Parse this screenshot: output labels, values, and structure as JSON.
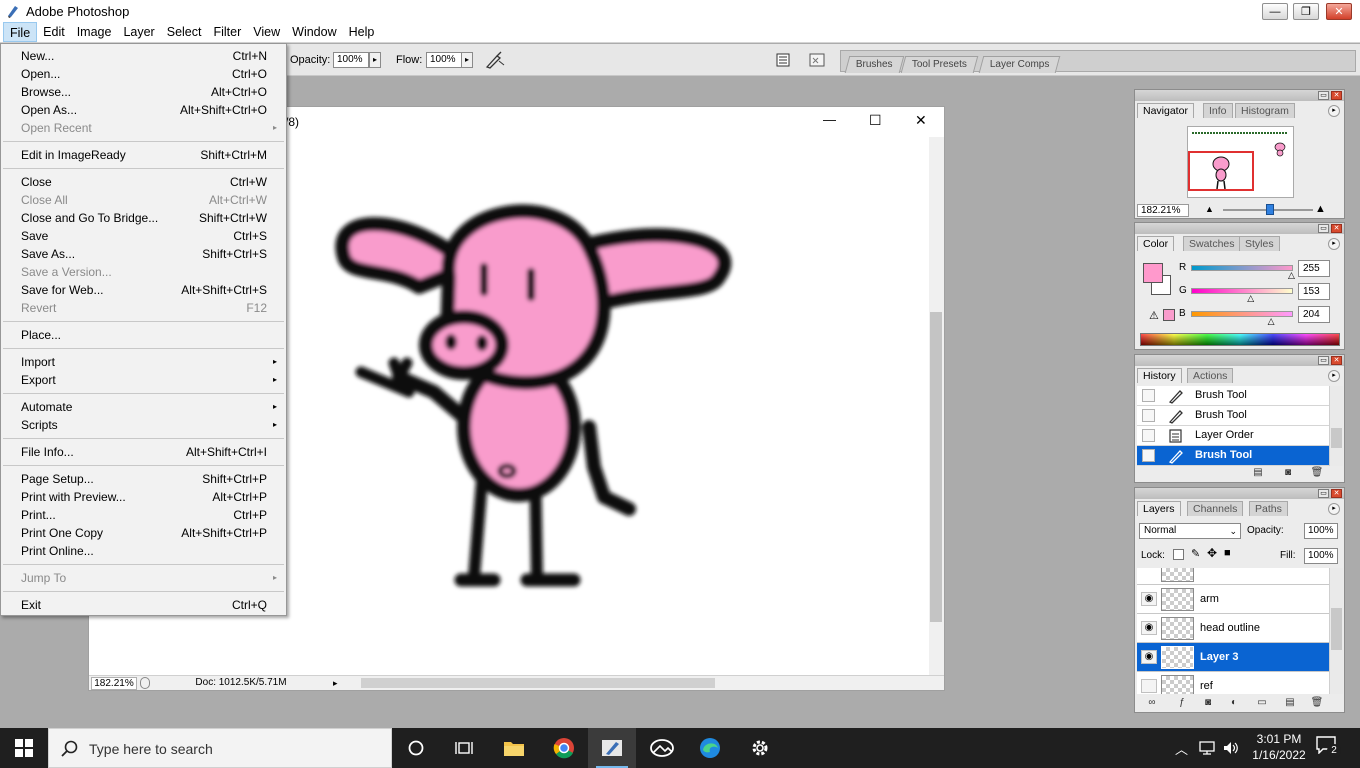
{
  "app": {
    "title": "Adobe Photoshop",
    "window_controls": {
      "minimize": "—",
      "restore": "❐",
      "close": "✕"
    }
  },
  "menubar": [
    "File",
    "Edit",
    "Image",
    "Layer",
    "Select",
    "Filter",
    "View",
    "Window",
    "Help"
  ],
  "options_bar": {
    "opacity_label": "Opacity:",
    "opacity_value": "100%",
    "flow_label": "Flow:",
    "flow_value": "100%",
    "dropdown_arrow": "▸"
  },
  "palette_well": {
    "tabs": [
      "Brushes",
      "Tool Presets",
      "Layer Comps"
    ]
  },
  "document": {
    "title_fragment": "/8)",
    "zoom": "182.21%",
    "doc_info": "Doc: 1012.5K/5.71M",
    "window_controls": {
      "minimize": "—",
      "maximize": "☐",
      "close": "✕"
    }
  },
  "file_menu": {
    "items": [
      {
        "label": "New...",
        "shortcut": "Ctrl+N",
        "disabled": false
      },
      {
        "label": "Open...",
        "shortcut": "Ctrl+O",
        "disabled": false
      },
      {
        "label": "Browse...",
        "shortcut": "Alt+Ctrl+O",
        "disabled": false
      },
      {
        "label": "Open As...",
        "shortcut": "Alt+Shift+Ctrl+O",
        "disabled": false
      },
      {
        "label": "Open Recent",
        "shortcut": "",
        "disabled": true,
        "submenu": true
      },
      {
        "label": "Edit in ImageReady",
        "shortcut": "Shift+Ctrl+M",
        "disabled": false
      },
      {
        "label": "Close",
        "shortcut": "Ctrl+W",
        "disabled": false
      },
      {
        "label": "Close All",
        "shortcut": "Alt+Ctrl+W",
        "disabled": true
      },
      {
        "label": "Close and Go To Bridge...",
        "shortcut": "Shift+Ctrl+W",
        "disabled": false
      },
      {
        "label": "Save",
        "shortcut": "Ctrl+S",
        "disabled": false
      },
      {
        "label": "Save As...",
        "shortcut": "Shift+Ctrl+S",
        "disabled": false
      },
      {
        "label": "Save a Version...",
        "shortcut": "",
        "disabled": true
      },
      {
        "label": "Save for Web...",
        "shortcut": "Alt+Shift+Ctrl+S",
        "disabled": false
      },
      {
        "label": "Revert",
        "shortcut": "F12",
        "disabled": true
      },
      {
        "label": "Place...",
        "shortcut": "",
        "disabled": false
      },
      {
        "label": "Import",
        "shortcut": "",
        "disabled": false,
        "submenu": true
      },
      {
        "label": "Export",
        "shortcut": "",
        "disabled": false,
        "submenu": true
      },
      {
        "label": "Automate",
        "shortcut": "",
        "disabled": false,
        "submenu": true
      },
      {
        "label": "Scripts",
        "shortcut": "",
        "disabled": false,
        "submenu": true
      },
      {
        "label": "File Info...",
        "shortcut": "Alt+Shift+Ctrl+I",
        "disabled": false
      },
      {
        "label": "Page Setup...",
        "shortcut": "Shift+Ctrl+P",
        "disabled": false
      },
      {
        "label": "Print with Preview...",
        "shortcut": "Alt+Ctrl+P",
        "disabled": false
      },
      {
        "label": "Print...",
        "shortcut": "Ctrl+P",
        "disabled": false
      },
      {
        "label": "Print One Copy",
        "shortcut": "Alt+Shift+Ctrl+P",
        "disabled": false
      },
      {
        "label": "Print Online...",
        "shortcut": "",
        "disabled": false
      },
      {
        "label": "Jump To",
        "shortcut": "",
        "disabled": true,
        "submenu": true
      },
      {
        "label": "Exit",
        "shortcut": "Ctrl+Q",
        "disabled": false
      }
    ],
    "submenu_arrow": "▸"
  },
  "navigator": {
    "tabs": [
      "Navigator",
      "Info",
      "Histogram"
    ],
    "zoom": "182.21%",
    "view_box_color": "#e03030"
  },
  "color_palette": {
    "tabs": [
      "Color",
      "Swatches",
      "Styles"
    ],
    "foreground": "#ff99cc",
    "background": "#ffffff",
    "channels": [
      {
        "label": "R",
        "value": "255",
        "fraction": 1.0
      },
      {
        "label": "G",
        "value": "153",
        "fraction": 0.6
      },
      {
        "label": "B",
        "value": "204",
        "fraction": 0.8
      }
    ]
  },
  "history": {
    "tabs": [
      "History",
      "Actions"
    ],
    "items": [
      {
        "label": "Brush Tool",
        "icon": "brush-icon",
        "selected": false
      },
      {
        "label": "Brush Tool",
        "icon": "brush-icon",
        "selected": false
      },
      {
        "label": "Layer Order",
        "icon": "layer-order-icon",
        "selected": false
      },
      {
        "label": "Brush Tool",
        "icon": "brush-icon",
        "selected": true
      }
    ]
  },
  "layers": {
    "tabs": [
      "Layers",
      "Channels",
      "Paths"
    ],
    "blend_mode": "Normal",
    "opacity_label": "Opacity:",
    "opacity_value": "100%",
    "lock_label": "Lock:",
    "fill_label": "Fill:",
    "fill_value": "100%",
    "items": [
      {
        "name": "arm",
        "visible": true,
        "selected": false
      },
      {
        "name": "head outline",
        "visible": true,
        "selected": false
      },
      {
        "name": "Layer 3",
        "visible": true,
        "selected": true
      },
      {
        "name": "ref",
        "visible": false,
        "selected": false
      }
    ]
  },
  "taskbar": {
    "search_placeholder": "Type here to search",
    "time": "3:01 PM",
    "date": "1/16/2022",
    "notification_count": "2"
  },
  "colors": {
    "selection_blue": "#0a64d2",
    "pink": "#f99ccc",
    "taskbar": "#1f1f1f"
  }
}
